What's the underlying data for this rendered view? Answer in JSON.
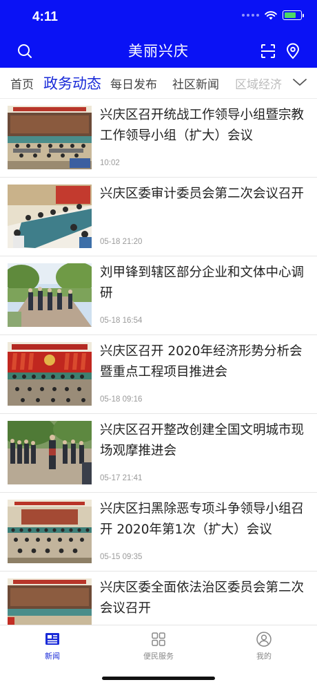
{
  "status": {
    "time": "4:11"
  },
  "header": {
    "title": "美丽兴庆"
  },
  "tabs": [
    {
      "label": "首页",
      "active": false
    },
    {
      "label": "政务动态",
      "active": true
    },
    {
      "label": "每日发布",
      "active": false
    },
    {
      "label": "社区新闻",
      "active": false
    },
    {
      "label": "区域经济",
      "active": false
    }
  ],
  "news": [
    {
      "title": "兴庆区召开统战工作领导小组暨宗教工作领导小组（扩大）会议",
      "time": "10:02",
      "scene": "meeting-banner"
    },
    {
      "title": "兴庆区委审计委员会第二次会议召开",
      "time": "05-18 21:20",
      "scene": "meeting-table"
    },
    {
      "title": "刘甲锋到辖区部分企业和文体中心调研",
      "time": "05-18 16:54",
      "scene": "outdoor-road"
    },
    {
      "title": "兴庆区召开 2020年经济形势分析会暨重点工程项目推进会",
      "time": "05-18 09:16",
      "scene": "meeting-flags"
    },
    {
      "title": "兴庆区召开整改创建全国文明城市现场观摩推进会",
      "time": "05-17 21:41",
      "scene": "outdoor-crowd"
    },
    {
      "title": "兴庆区扫黑除恶专项斗争领导小组召开 2020年第1次（扩大）会议",
      "time": "05-15 09:35",
      "scene": "meeting-hall"
    },
    {
      "title": "兴庆区委全面依法治区委员会第二次会议召开",
      "time": "",
      "scene": "meeting-banner"
    }
  ],
  "bottom_nav": [
    {
      "label": "新闻",
      "icon": "news-icon",
      "active": true
    },
    {
      "label": "便民服务",
      "icon": "grid-icon",
      "active": false
    },
    {
      "label": "我的",
      "icon": "user-icon",
      "active": false
    }
  ],
  "colors": {
    "brand_blue": "#0a12f5",
    "active_tab": "#1a2bd8"
  }
}
